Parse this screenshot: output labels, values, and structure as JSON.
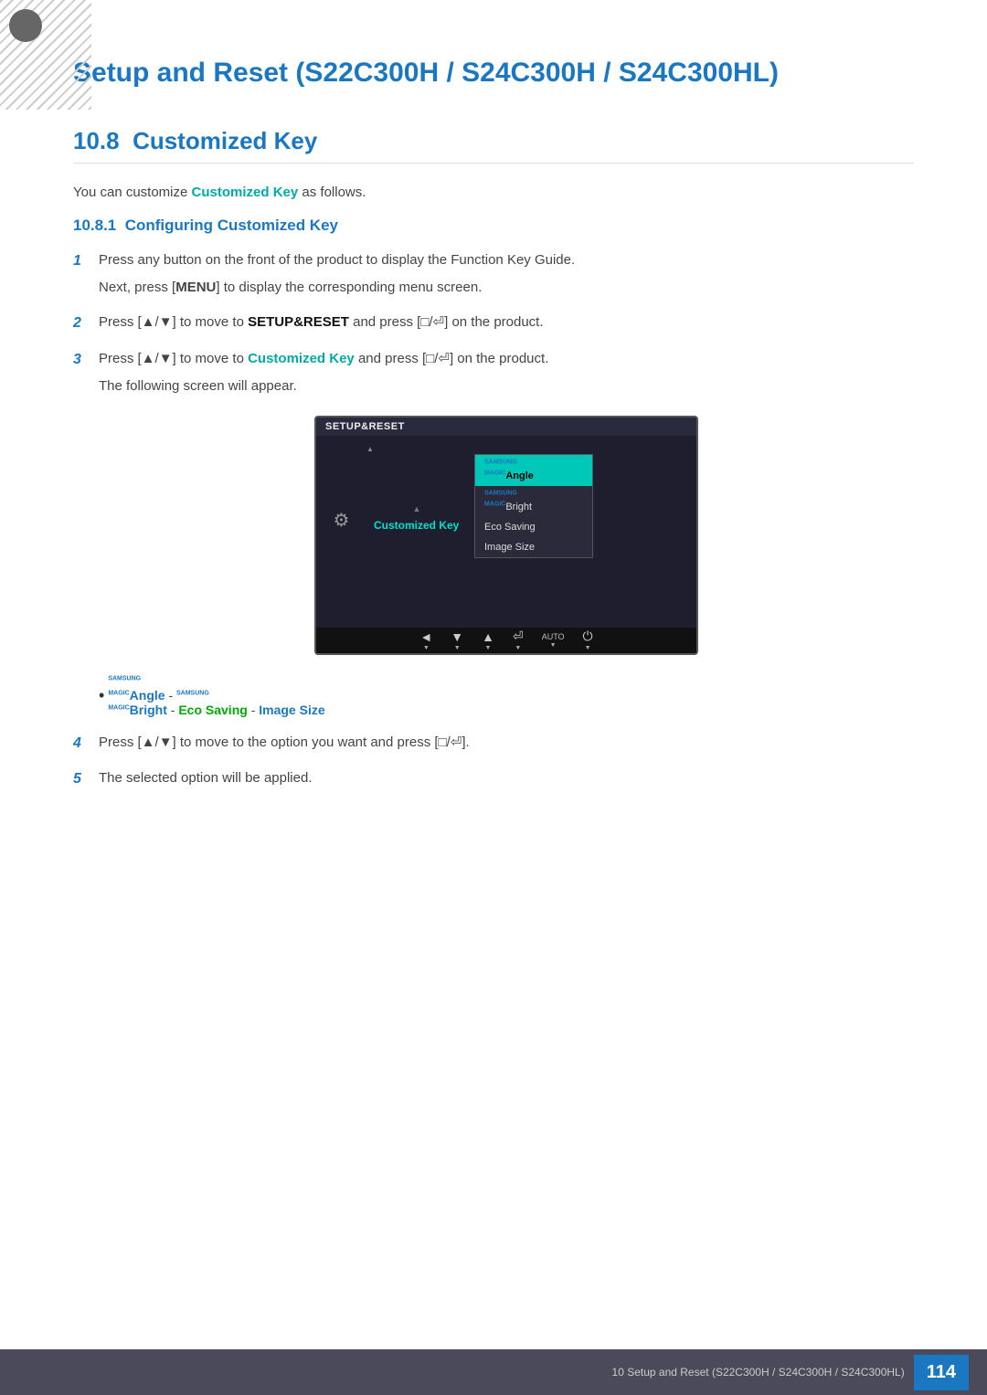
{
  "header": {
    "chapter_title": "Setup and Reset (S22C300H / S24C300H / S24C300HL)"
  },
  "section": {
    "number": "10.8",
    "title": "Customized Key",
    "intro": "You can customize",
    "intro_bold": "Customized Key",
    "intro_end": "as follows."
  },
  "subsection": {
    "number": "10.8.1",
    "title": "Configuring Customized Key"
  },
  "steps": [
    {
      "number": "1",
      "text": "Press any button on the front of the product to display the Function Key Guide.",
      "sub": "Next, press [MENU] to display the corresponding menu screen."
    },
    {
      "number": "2",
      "text_pre": "Press [▲/▼] to move to",
      "text_bold": "SETUP&RESET",
      "text_post": "and press [□/⏎] on the product."
    },
    {
      "number": "3",
      "text_pre": "Press [▲/▼] to move to",
      "text_bold": "Customized Key",
      "text_post": "and press [□/⏎] on the product.",
      "sub": "The following screen will appear."
    },
    {
      "number": "4",
      "text": "Press [▲/▼] to move to the option you want and press [□/⏎]."
    },
    {
      "number": "5",
      "text": "The selected option will be applied."
    }
  ],
  "screen": {
    "menu_title": "SETUP&RESET",
    "active_item": "Customized Key",
    "submenu_items": [
      {
        "label": "Angle",
        "prefix": "SAMSUNG MAGIC",
        "highlighted": true
      },
      {
        "label": "Bright",
        "prefix": "SAMSUNG MAGIC",
        "highlighted": false
      },
      {
        "label": "Eco Saving",
        "highlighted": false
      },
      {
        "label": "Image Size",
        "highlighted": false
      }
    ],
    "bottom_icons": [
      "◄",
      "▼",
      "▲",
      "⏎",
      "AUTO",
      "⏻"
    ]
  },
  "bullet": {
    "items": [
      {
        "prefix1": "SAMSUNG",
        "magic1": "MAGIC",
        "bold1": "Angle",
        "sep1": " - ",
        "prefix2": "SAMSUNG",
        "magic2": "MAGIC",
        "bold2": "Bright",
        "sep2": " - ",
        "eco": "Eco Saving",
        "sep3": " - ",
        "size": "Image Size"
      }
    ]
  },
  "footer": {
    "text": "10 Setup and Reset (S22C300H / S24C300H / S24C300HL)",
    "page": "114"
  }
}
